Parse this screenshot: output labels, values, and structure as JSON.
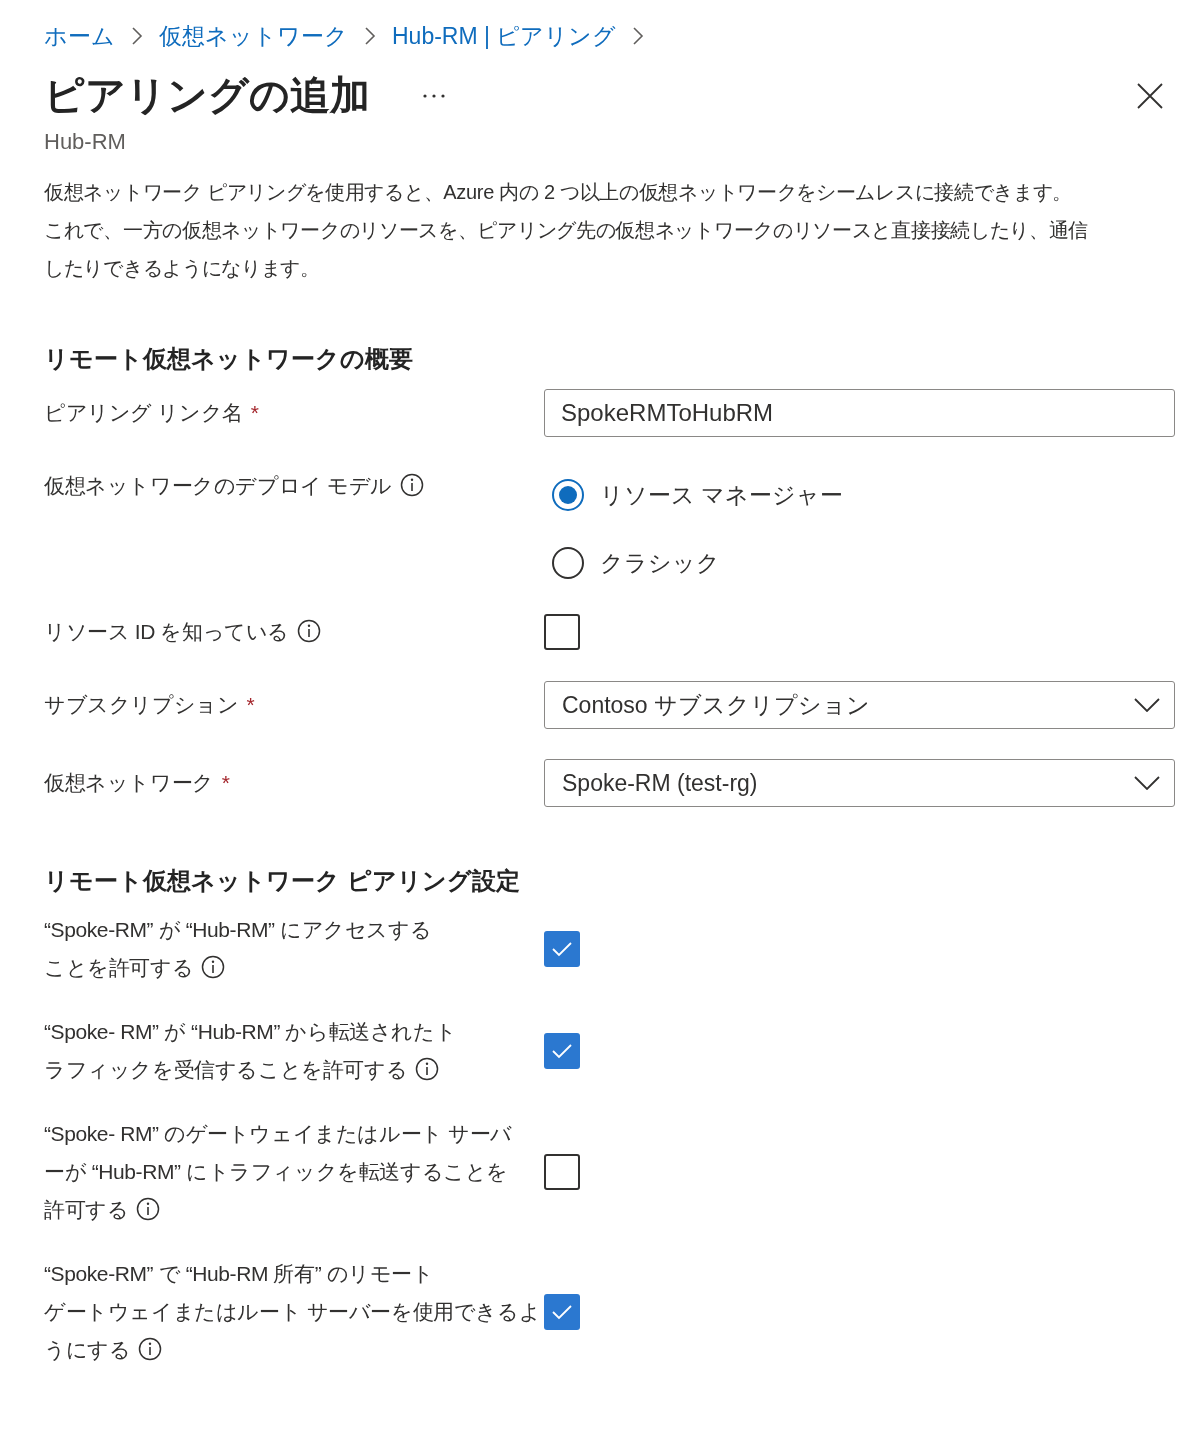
{
  "breadcrumb": [
    "ホーム",
    "仮想ネットワーク",
    "Hub-RM | ピアリング"
  ],
  "title": "ピアリングの追加",
  "subtitle": "Hub-RM",
  "description": [
    "仮想ネットワーク ピアリングを使用すると、Azure 内の 2 つ以上の仮想ネットワークをシームレスに接続できます。",
    "これで、一方の仮想ネットワークのリソースを、ピアリング先の仮想ネットワークのリソースと直接接続したり、通信",
    "したりできるようになります。"
  ],
  "sections": [
    {
      "heading": "リモート仮想ネットワークの概要",
      "fields": [
        {
          "kind": "text",
          "label": [
            "ピアリング リンク名"
          ],
          "required_mark": "*",
          "value": "SpokeRMToHubRM"
        },
        {
          "kind": "radio",
          "label": [
            "仮想ネットワークのデプロイ モデル"
          ],
          "info": true,
          "options": [
            {
              "label": "リソース マネージャー",
              "selected": true
            },
            {
              "label": "クラシック",
              "selected": false
            }
          ]
        },
        {
          "kind": "checkbox",
          "label": [
            "リソース ID を知っている"
          ],
          "info": true,
          "checked": false
        },
        {
          "kind": "select",
          "label": [
            "サブスクリプション"
          ],
          "required_mark": "*",
          "value": "Contoso サブスクリプション"
        },
        {
          "kind": "select",
          "label": [
            "仮想ネットワーク"
          ],
          "required_mark": "*",
          "value": "Spoke-RM (test-rg)"
        }
      ]
    },
    {
      "heading": "リモート仮想ネットワーク ピアリング設定",
      "fields": [
        {
          "kind": "checkbox",
          "label": [
            "“Spoke-RM” が “Hub-RM” にアクセスする",
            "ことを許可する"
          ],
          "info": true,
          "checked": true
        },
        {
          "kind": "checkbox",
          "label": [
            "“Spoke- RM” が “Hub-RM” から転送されたト",
            "ラフィックを受信することを許可する"
          ],
          "info": true,
          "checked": true
        },
        {
          "kind": "checkbox",
          "label": [
            "“Spoke- RM” のゲートウェイまたはルート サーバ",
            "ーが “Hub-RM” にトラフィックを転送することを",
            "許可する"
          ],
          "info": true,
          "checked": false
        },
        {
          "kind": "checkbox",
          "label": [
            "“Spoke-RM” で “Hub-RM 所有” のリモート",
            "ゲートウェイまたはルート サーバーを使用できるよ",
            "うにする"
          ],
          "info": true,
          "checked": true
        }
      ]
    }
  ]
}
